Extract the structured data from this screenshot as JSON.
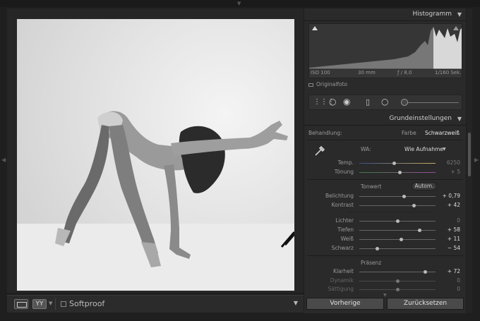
{
  "histogram": {
    "title": "Histogramm",
    "iso": "ISO 100",
    "focal": "30 mm",
    "aperture": "ƒ / 8,0",
    "shutter": "1/160 Sek.",
    "original_label": "Originalfoto"
  },
  "basic": {
    "title": "Grundeinstellungen",
    "treatment_label": "Behandlung:",
    "treatment_color": "Farbe",
    "treatment_bw": "Schwarzweiß",
    "wb_label": "WA:",
    "wb_value": "Wie Aufnahme",
    "temp": {
      "label": "Temp.",
      "value": "6250",
      "pos": 0.45
    },
    "tint": {
      "label": "Tönung",
      "value": "+ 5",
      "pos": 0.53
    },
    "tone_title": "Tonwert",
    "auto_label": "Autom.",
    "exposure": {
      "label": "Belichtung",
      "value": "+ 0,79",
      "pos": 0.58
    },
    "contrast": {
      "label": "Kontrast",
      "value": "+ 42",
      "pos": 0.71
    },
    "highlights": {
      "label": "Lichter",
      "value": "0",
      "pos": 0.5
    },
    "shadows": {
      "label": "Tiefen",
      "value": "+ 58",
      "pos": 0.79
    },
    "whites": {
      "label": "Weiß",
      "value": "+ 11",
      "pos": 0.55
    },
    "blacks": {
      "label": "Schwarz",
      "value": "− 54",
      "pos": 0.23
    },
    "presence_title": "Präsenz",
    "clarity": {
      "label": "Klarheit",
      "value": "+ 72",
      "pos": 0.86
    },
    "vibrance": {
      "label": "Dynamik",
      "value": "0",
      "pos": 0.5
    },
    "saturation": {
      "label": "Sättigung",
      "value": "0",
      "pos": 0.5
    }
  },
  "toolbar": {
    "yy_label": "YY",
    "softproof_label": "Softproof"
  },
  "buttons": {
    "previous": "Vorherige",
    "reset": "Zurücksetzen"
  }
}
